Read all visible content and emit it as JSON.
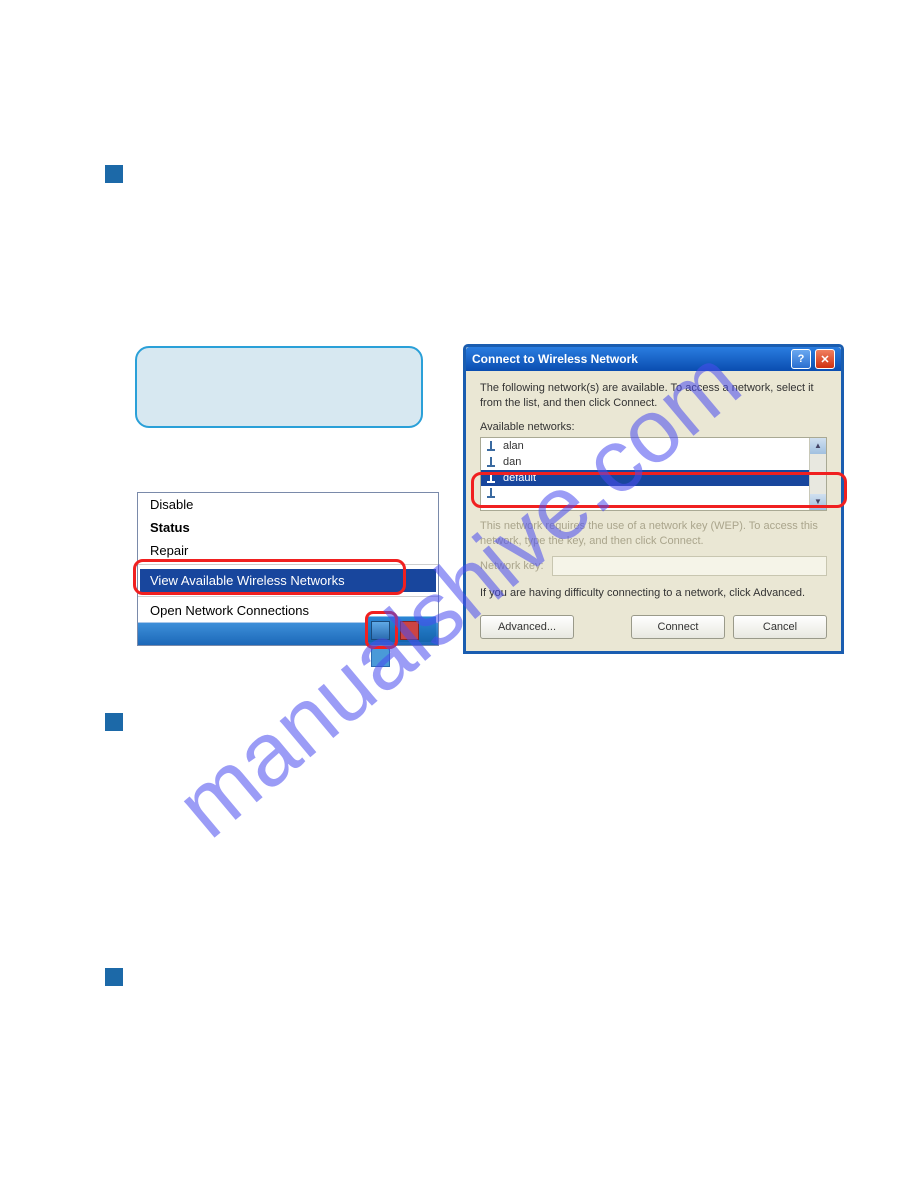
{
  "watermark": "manualshive.com",
  "context_menu": {
    "items": [
      "Disable",
      "Status",
      "Repair"
    ],
    "highlighted": "View Available Wireless Networks",
    "footer_item": "Open Network Connections"
  },
  "dialog": {
    "title": "Connect to Wireless Network",
    "description": "The following network(s) are available. To access a network, select it from the list, and then click Connect.",
    "list_label": "Available networks:",
    "networks": [
      "alan",
      "dan",
      "default",
      ""
    ],
    "selected_index": 2,
    "wep_note": "This network requires the use of a network key (WEP). To access this network, type the key, and then click Connect.",
    "key_label": "Network key:",
    "advanced_note": "If you are having difficulty connecting to a network, click Advanced.",
    "buttons": {
      "advanced": "Advanced...",
      "connect": "Connect",
      "cancel": "Cancel"
    }
  }
}
